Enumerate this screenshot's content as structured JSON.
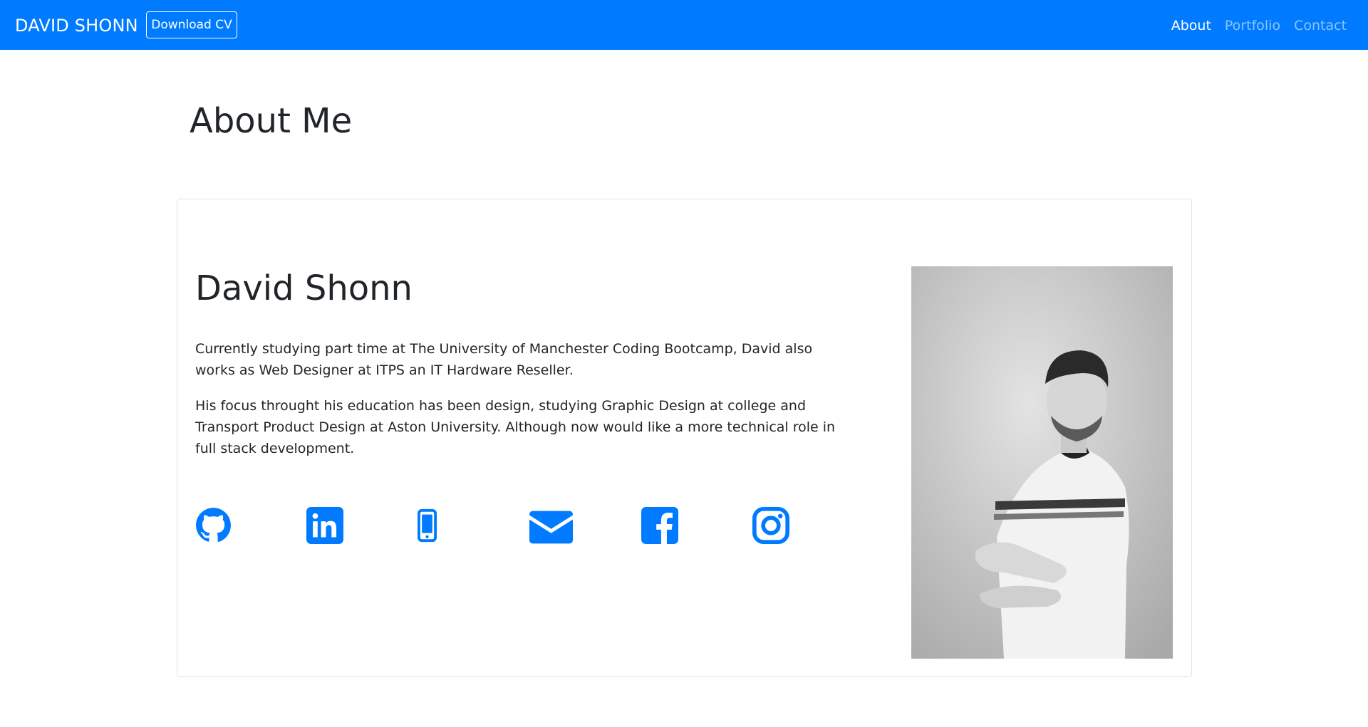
{
  "navbar": {
    "brand": "DAVID SHONN",
    "download_cv": "Download CV",
    "links": [
      "About",
      "Portfolio",
      "Contact"
    ],
    "active_link": "About",
    "background_color": "#007bff"
  },
  "page": {
    "title": "About Me"
  },
  "profile": {
    "name": "David Shonn",
    "paragraphs": [
      "Currently studying part time at The University of Manchester Coding Bootcamp, David also works as Web Designer at ITPS an IT Hardware Reseller.",
      "His focus throught his education has been design, studying Graphic Design at college and Transport Product Design at Aston University. Although now would like a more technical role in full stack development."
    ],
    "social_icons": [
      "github-icon",
      "linkedin-icon",
      "mobile-phone-icon",
      "envelope-icon",
      "facebook-icon",
      "instagram-icon"
    ],
    "icon_color": "#007bff",
    "photo": "black-and-white-portrait"
  }
}
